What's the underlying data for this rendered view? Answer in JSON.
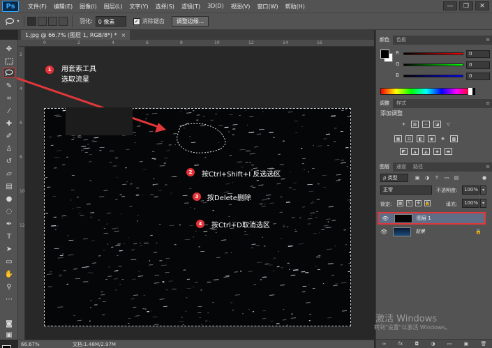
{
  "app": {
    "logo": "Ps"
  },
  "menu": [
    "文件(F)",
    "编辑(E)",
    "图像(I)",
    "图层(L)",
    "文字(Y)",
    "选择(S)",
    "滤镜(T)",
    "3D(D)",
    "视图(V)",
    "窗口(W)",
    "帮助(H)"
  ],
  "window_controls": {
    "minimize": "—",
    "restore": "❐",
    "close": "✕"
  },
  "options": {
    "feather_label": "羽化:",
    "feather_value": "0 像素",
    "antialias_label": "消除锯齿",
    "antialias_checked": "✓",
    "refine_edge": "调整边缘..."
  },
  "document_tab": {
    "title": "1.jpg @ 66.7% (图层 1, RGB/8*) *",
    "close": "×"
  },
  "rulers": {
    "top": [
      "0",
      "2",
      "4",
      "6",
      "8",
      "10",
      "12",
      "14",
      "16"
    ],
    "left": [
      "2",
      "4",
      "6",
      "8",
      "10",
      "12"
    ]
  },
  "annotations": {
    "note1": {
      "num": "1",
      "text": "用套索工具\n选取流星"
    },
    "note2": {
      "num": "2",
      "text": "按Ctrl+Shift+I 反选选区"
    },
    "note3": {
      "num": "3",
      "text": "按Delete删除"
    },
    "note4": {
      "num": "4",
      "text": "按Ctrl+D取消选区"
    }
  },
  "status": {
    "zoom": "66.67%",
    "doc": "文档:1.48M/2.97M"
  },
  "color_panel": {
    "tabs": [
      "颜色",
      "色板"
    ],
    "r_label": "R",
    "g_label": "G",
    "b_label": "B",
    "r_value": "0",
    "g_value": "0",
    "b_value": "0"
  },
  "adjust_panel": {
    "tabs": [
      "调整",
      "样式"
    ],
    "add_label": "添加调整"
  },
  "layers_panel": {
    "tabs": [
      "图层",
      "通道",
      "路径"
    ],
    "kind": "ρ 类型",
    "blend_mode": "正常",
    "opacity_label": "不透明度:",
    "opacity_value": "100%",
    "lock_label": "锁定:",
    "fill_label": "填充:",
    "fill_value": "100%",
    "layers": [
      {
        "name": "图层 1",
        "selected": true
      },
      {
        "name": "背景",
        "locked": true
      }
    ],
    "footer": [
      "∞",
      "fx",
      "◘",
      "◑",
      "▭",
      "▣",
      "🗑"
    ]
  },
  "watermark": {
    "line1": "激活 Windows",
    "line2": "转到\"设置\"以激活 Windows。"
  },
  "colors": {
    "accent_red": "#e2373a",
    "selection_blue": "#5f6e86",
    "panel_bg": "#535353"
  }
}
